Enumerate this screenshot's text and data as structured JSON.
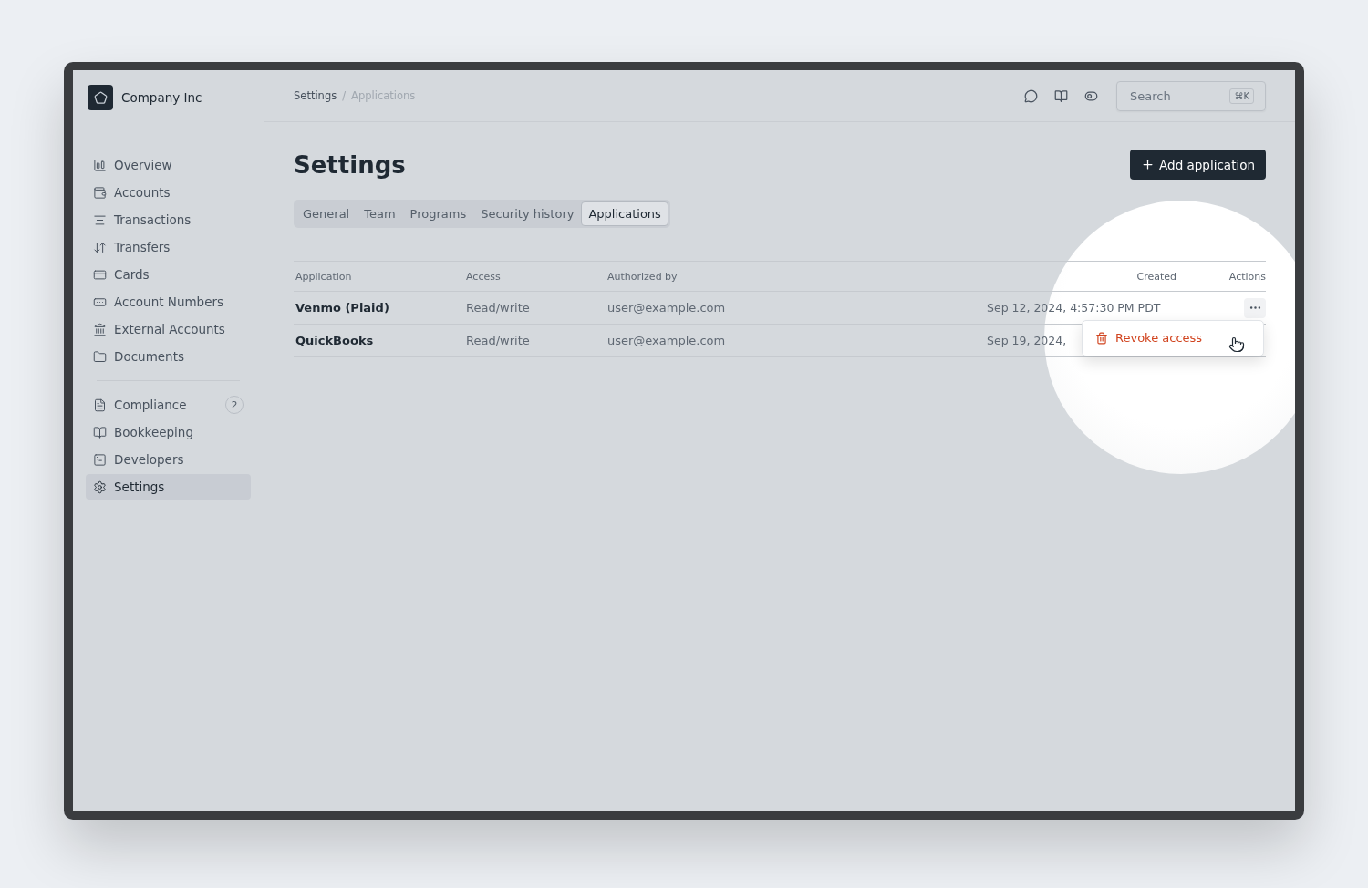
{
  "sidebar": {
    "company": "Company Inc",
    "groups": [
      {
        "items": [
          {
            "label": "Overview",
            "selected": false
          },
          {
            "label": "Accounts",
            "selected": false
          },
          {
            "label": "Transactions",
            "selected": false
          },
          {
            "label": "Transfers",
            "selected": false
          },
          {
            "label": "Cards",
            "selected": false
          },
          {
            "label": "Account Numbers",
            "selected": false
          },
          {
            "label": "External Accounts",
            "selected": false
          },
          {
            "label": "Documents",
            "selected": false
          }
        ]
      },
      {
        "items": [
          {
            "label": "Compliance",
            "selected": false,
            "badge": "2"
          },
          {
            "label": "Bookkeeping",
            "selected": false
          },
          {
            "label": "Developers",
            "selected": false
          },
          {
            "label": "Settings",
            "selected": true
          }
        ]
      }
    ]
  },
  "breadcrumbs": [
    "Settings",
    "Applications"
  ],
  "breadcrumb_separator": "/",
  "search": {
    "placeholder": "Search",
    "shortcut": "⌘K"
  },
  "page": {
    "title": "Settings",
    "action": "Add application"
  },
  "tabs": [
    {
      "label": "General",
      "selected": false
    },
    {
      "label": "Team",
      "selected": false
    },
    {
      "label": "Programs",
      "selected": false
    },
    {
      "label": "Security history",
      "selected": false
    },
    {
      "label": "Applications",
      "selected": true
    }
  ],
  "table": {
    "columns": [
      "Application",
      "Access",
      "Authorized by",
      "Created",
      "Actions"
    ],
    "rows": [
      {
        "application": "Venmo (Plaid)",
        "access": "Read/write",
        "authorized_by": "user@example.com",
        "created": "Sep 12, 2024, 4:57:30 PM PDT",
        "menu": {
          "items": [
            {
              "label": "Revoke access",
              "kind": "danger"
            }
          ]
        }
      },
      {
        "application": "QuickBooks",
        "access": "Read/write",
        "authorized_by": "user@example.com",
        "created": "Sep 19, 2024,"
      }
    ]
  }
}
